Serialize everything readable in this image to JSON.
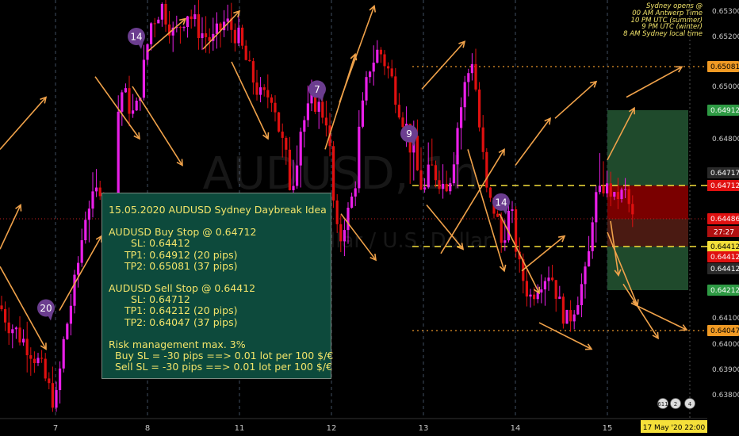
{
  "symbol_watermark": "AUDUSD, 1h",
  "subtitle_watermark": "Australian Dollar / U.S. Dollar",
  "colors": {
    "bull": "#e91fe8",
    "bear": "#e01010",
    "arrow": "#f0a24a",
    "dashed_yellow": "#f5e03a",
    "level_dotted": "#e8952a",
    "tp_zone": "#1f4a2c",
    "sl_zone": "#7a0000",
    "badge": "#6b3d8f"
  },
  "note": {
    "title": "15.05.2020 AUDUSD Sydney Daybreak Idea",
    "buy_header": "AUDUSD Buy Stop @ 0.64712",
    "buy_sl": "SL: 0.64412",
    "buy_tp1": "TP1: 0.64912 (20 pips)",
    "buy_tp2": "TP2: 0.65081 (37 pips)",
    "sell_header": "AUDUSD Sell Stop @ 0.64412",
    "sell_sl": "SL: 0.64712",
    "sell_tp1": "TP1: 0.64212 (20 pips)",
    "sell_tp2": "TP2: 0.64047 (37 pips)",
    "risk": "Risk management max. 3%",
    "buy_lot": "Buy SL = -30 pips ==> 0.01 lot per 100 $/€",
    "sell_lot": "Sell SL = -30 pips ==> 0.01 lot per 100 $/€"
  },
  "sydney_note": {
    "l1": "Sydney opens @",
    "l2": "00 AM Antwerp Time",
    "l3": "10 PM UTC (summer)",
    "l4": "9 PM UTC (winter)",
    "l5": "8 AM Sydney local time"
  },
  "badges": [
    {
      "label": "14",
      "price": 0.652
    },
    {
      "label": "7",
      "price": 0.6499
    },
    {
      "label": "9",
      "price": 0.6482
    },
    {
      "label": "14",
      "price": 0.646
    },
    {
      "label": "20",
      "price": 0.6414
    }
  ],
  "bottom_right_icons": [
    "611",
    "2",
    "4"
  ],
  "chart_data": {
    "type": "candlestick",
    "y_ticks": [
      0.638,
      0.639,
      0.64,
      0.641,
      0.644,
      0.648,
      0.65,
      0.652,
      0.653
    ],
    "x_ticks": [
      "7",
      "8",
      "11",
      "12",
      "13",
      "14",
      "15"
    ],
    "ylim": [
      0.6375,
      0.6535
    ],
    "levels": [
      {
        "price": 0.65081,
        "label": "0.65081",
        "style": "dotted",
        "color": "#f09a24"
      },
      {
        "price": 0.64912,
        "label": "0.64912",
        "style": "none",
        "color": "#2e9a44"
      },
      {
        "price": 0.64712,
        "label": "0.64712",
        "style": "dashed",
        "color": "#f5e03a"
      },
      {
        "price": 0.64717,
        "label": "0.64717",
        "style": "none",
        "color": "#2a2a2a"
      },
      {
        "price": 0.64712,
        "label": "0.64712",
        "style": "none",
        "color": "#e01010"
      },
      {
        "price": 0.64486,
        "label": "0.64486",
        "style": "dotted-red",
        "color": "#e01010"
      },
      {
        "price": 0.64412,
        "label": "0.64412",
        "style": "dashed",
        "color": "#f5e03a"
      },
      {
        "price": 0.64412,
        "label": "0.64412",
        "style": "none",
        "color": "#e01010"
      },
      {
        "price": 0.64412,
        "label": "0.64412",
        "style": "none",
        "color": "#2a2a2a"
      },
      {
        "price": 0.64212,
        "label": "0.64212",
        "style": "none",
        "color": "#2e9a44"
      },
      {
        "price": 0.64047,
        "label": "0.64047",
        "style": "dotted",
        "color": "#f09a24"
      }
    ],
    "countdown": "27:27",
    "current_time": "17 May '20  22:00"
  }
}
